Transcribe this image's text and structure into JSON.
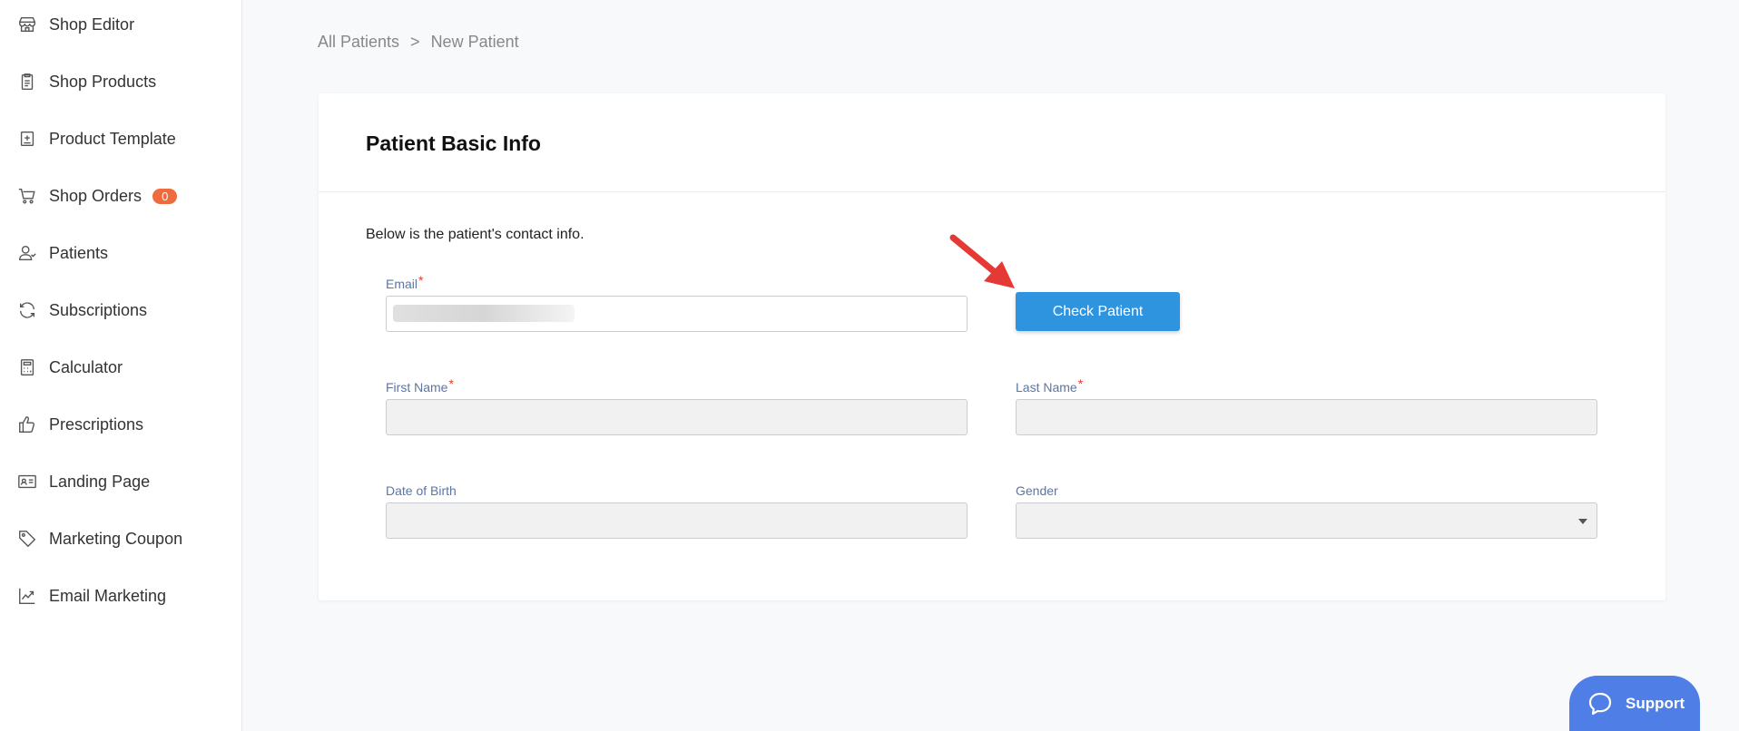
{
  "sidebar": {
    "items": [
      {
        "label": "Shop Editor",
        "icon": "store-icon"
      },
      {
        "label": "Shop Products",
        "icon": "clipboard-icon"
      },
      {
        "label": "Product Template",
        "icon": "template-icon"
      },
      {
        "label": "Shop Orders",
        "icon": "cart-icon",
        "badge": "0"
      },
      {
        "label": "Patients",
        "icon": "user-icon"
      },
      {
        "label": "Subscriptions",
        "icon": "refresh-icon"
      },
      {
        "label": "Calculator",
        "icon": "calculator-icon"
      },
      {
        "label": "Prescriptions",
        "icon": "thumbs-up-icon"
      },
      {
        "label": "Landing Page",
        "icon": "id-card-icon"
      },
      {
        "label": "Marketing Coupon",
        "icon": "tag-icon"
      },
      {
        "label": "Email Marketing",
        "icon": "chart-line-icon"
      }
    ]
  },
  "breadcrumb": {
    "parent": "All Patients",
    "separator": ">",
    "current": "New Patient"
  },
  "card": {
    "title": "Patient Basic Info",
    "intro": "Below is the patient's contact info.",
    "fields": {
      "email": {
        "label": "Email",
        "required": "*",
        "value": ""
      },
      "first_name": {
        "label": "First Name",
        "required": "*",
        "value": ""
      },
      "last_name": {
        "label": "Last Name",
        "required": "*",
        "value": ""
      },
      "dob": {
        "label": "Date of Birth",
        "value": ""
      },
      "gender": {
        "label": "Gender",
        "value": ""
      }
    },
    "check_button": "Check Patient"
  },
  "support": {
    "label": "Support"
  },
  "colors": {
    "accent": "#2f94e0",
    "badge": "#ef6a3d",
    "support": "#4e7ee6",
    "arrow": "#e53935"
  }
}
